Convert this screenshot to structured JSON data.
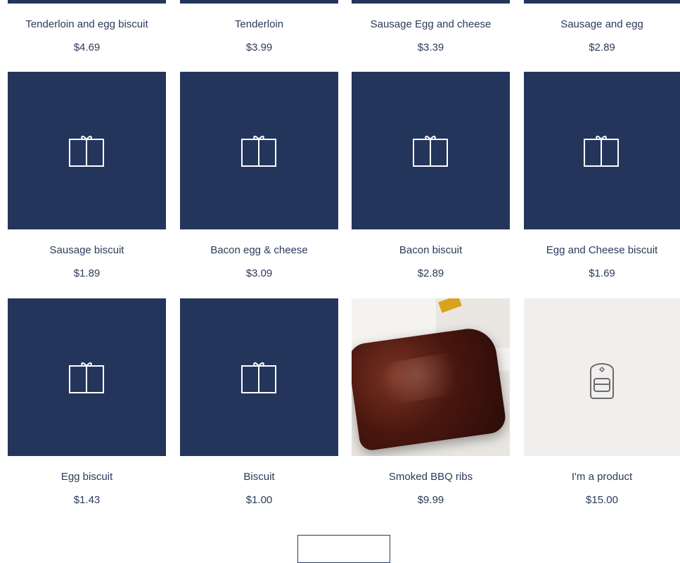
{
  "products": [
    {
      "name": "Tenderloin and egg biscuit",
      "price": "$4.69",
      "image": "gift-icon"
    },
    {
      "name": "Tenderloin",
      "price": "$3.99",
      "image": "gift-icon"
    },
    {
      "name": "Sausage Egg and cheese",
      "price": "$3.39",
      "image": "gift-icon"
    },
    {
      "name": "Sausage and egg",
      "price": "$2.89",
      "image": "gift-icon"
    },
    {
      "name": "Sausage biscuit",
      "price": "$1.89",
      "image": "gift-icon"
    },
    {
      "name": "Bacon egg & cheese",
      "price": "$3.09",
      "image": "gift-icon"
    },
    {
      "name": "Bacon biscuit",
      "price": "$2.89",
      "image": "gift-icon"
    },
    {
      "name": "Egg and Cheese biscuit",
      "price": "$1.69",
      "image": "gift-icon"
    },
    {
      "name": "Egg biscuit",
      "price": "$1.43",
      "image": "gift-icon"
    },
    {
      "name": "Biscuit",
      "price": "$1.00",
      "image": "gift-icon"
    },
    {
      "name": "Smoked BBQ ribs",
      "price": "$9.99",
      "image": "ribs-photo"
    },
    {
      "name": "I'm a product",
      "price": "$15.00",
      "image": "backpack-icon"
    }
  ],
  "colors": {
    "tile": "#24355c",
    "text": "#2b3a5a",
    "placeholder_light": "#f1efee"
  },
  "load_more_button": {
    "label": ""
  }
}
